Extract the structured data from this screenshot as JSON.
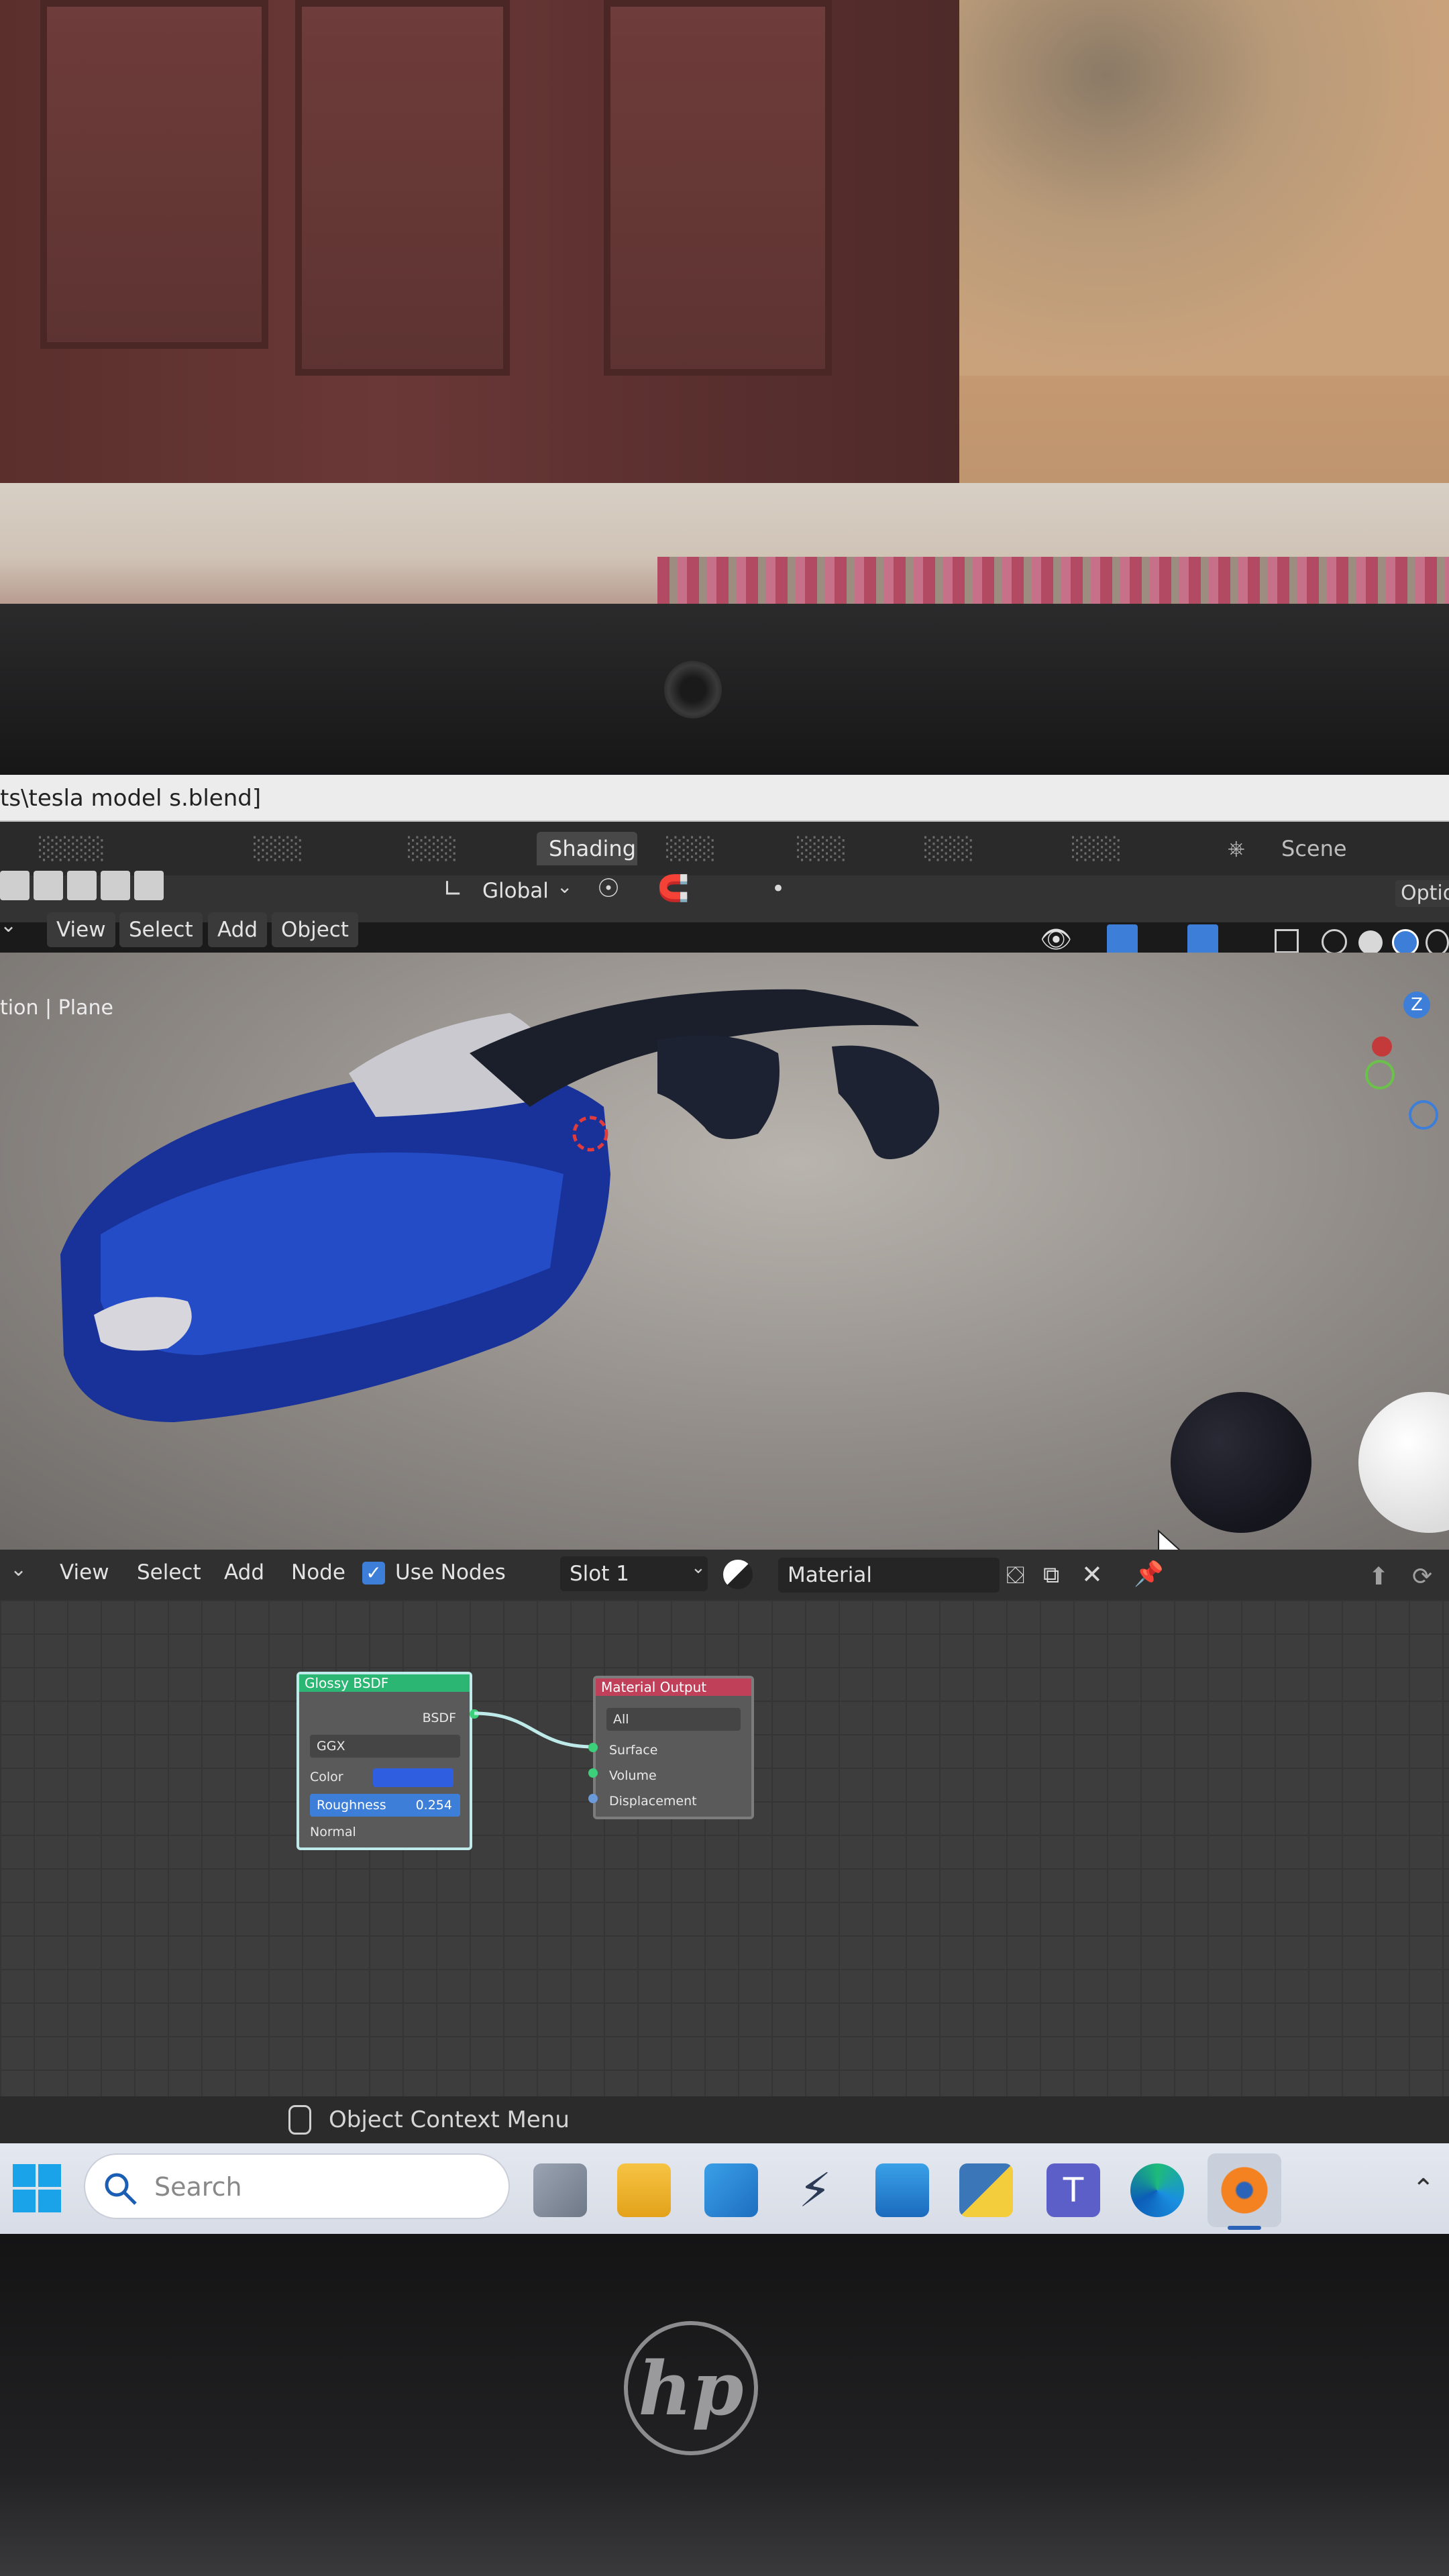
{
  "window": {
    "title": "ts\\tesla model s.blend]"
  },
  "workspace": {
    "active_tab": "Shading",
    "scene": "Scene",
    "options": "Optio"
  },
  "viewport_header": {
    "menus": [
      "View",
      "Select",
      "Add",
      "Object"
    ],
    "transform_orientation": "Global",
    "context_label": "tion | Plane"
  },
  "node_editor": {
    "menus": [
      "View",
      "Select",
      "Add",
      "Node"
    ],
    "use_nodes_label": "Use Nodes",
    "use_nodes_checked": true,
    "slot": "Slot 1",
    "material": "Material"
  },
  "nodes": {
    "glossy": {
      "title": "Glossy BSDF",
      "output": "BSDF",
      "distribution": "GGX",
      "color_label": "Color",
      "color_value": "#2f5fe0",
      "roughness_label": "Roughness",
      "roughness_value": "0.254",
      "normal_label": "Normal"
    },
    "output": {
      "title": "Material Output",
      "target": "All",
      "inputs": [
        "Surface",
        "Volume",
        "Displacement"
      ]
    }
  },
  "status": {
    "text": "Object Context Menu"
  },
  "taskbar": {
    "search_placeholder": "Search"
  },
  "brand": {
    "logo_text": "hp"
  },
  "colors": {
    "car_body": "#1a3fb0",
    "node_glossy_header": "#2bb673",
    "node_output_header": "#c0405a",
    "accent_blue": "#2f7fe0"
  }
}
